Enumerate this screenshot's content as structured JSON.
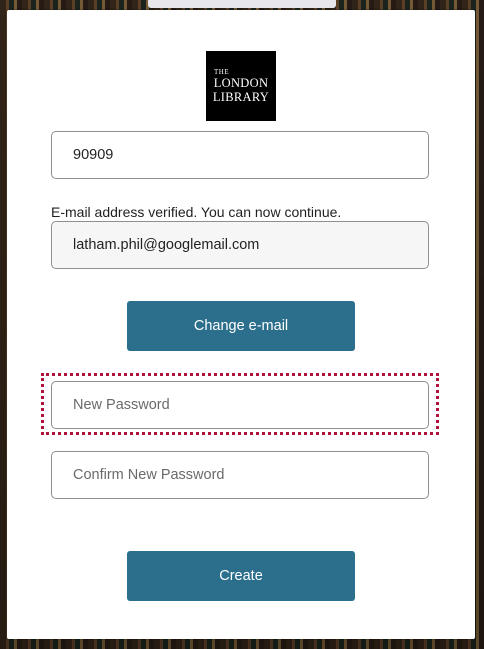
{
  "logo": {
    "line1": "THE",
    "line2": "LONDON",
    "line3": "LIBRARY"
  },
  "form": {
    "code_value": "90909",
    "verified_message": "E-mail address verified. You can now continue.",
    "email_value": "latham.phil@googlemail.com",
    "change_email_label": "Change e-mail",
    "new_password_placeholder": "New Password",
    "confirm_password_placeholder": "Confirm New Password",
    "create_label": "Create"
  },
  "colors": {
    "button_bg": "#2b6f8c",
    "focus_ring": "#b0133a"
  }
}
